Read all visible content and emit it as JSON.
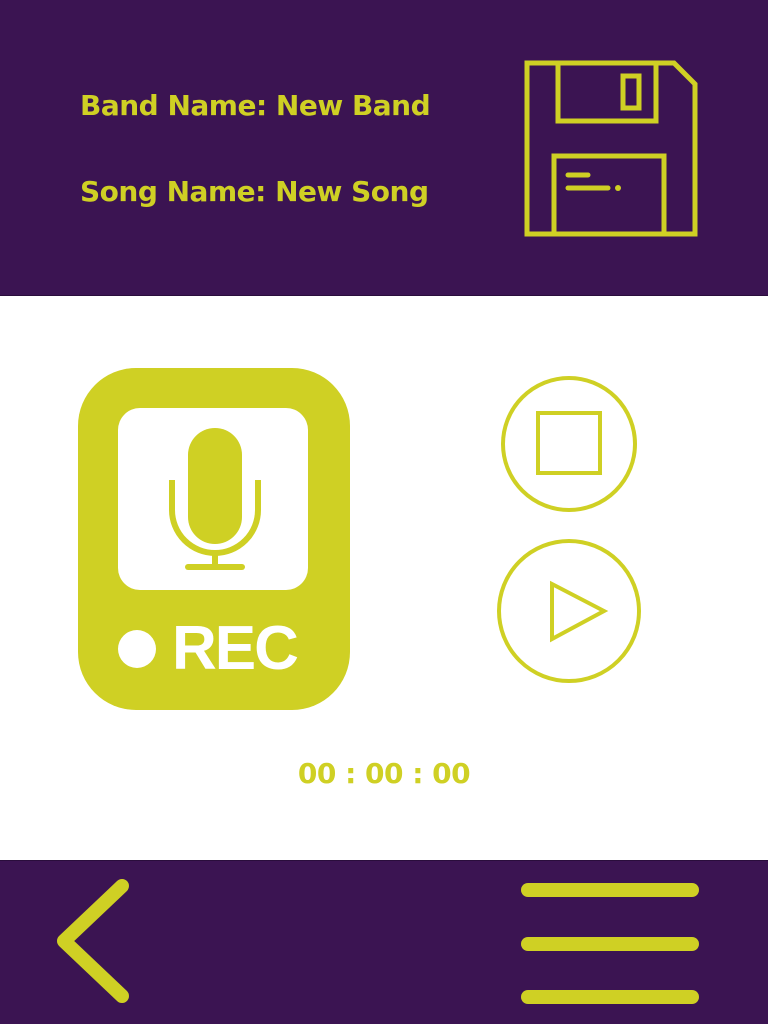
{
  "header": {
    "band_name": "Band Name: New Band",
    "song_name": "Song Name: New Song",
    "save_icon": "floppy-disk-icon"
  },
  "recorder": {
    "rec_label": "REC",
    "mic_icon": "microphone-icon",
    "stop_icon": "stop-icon",
    "play_icon": "play-icon",
    "timer": "00 : 00 : 00"
  },
  "footer": {
    "back_icon": "chevron-left-icon",
    "menu_icon": "hamburger-menu-icon"
  },
  "colors": {
    "primary": "#3b1452",
    "accent": "#cfd024",
    "background": "#ffffff"
  }
}
